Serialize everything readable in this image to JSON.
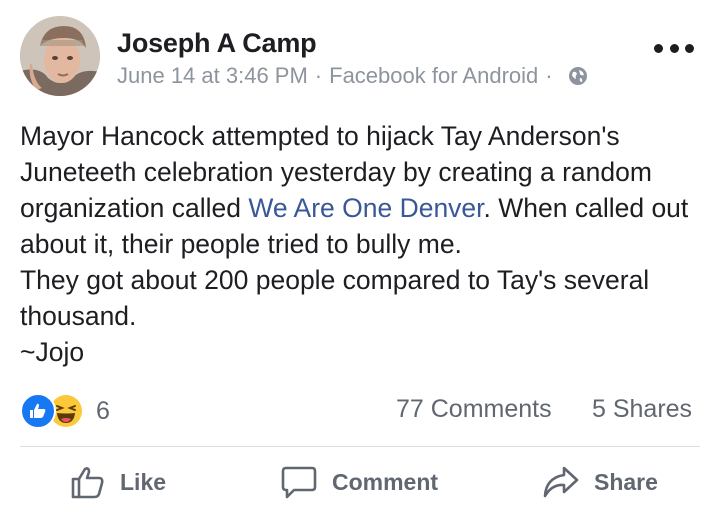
{
  "post": {
    "author": "Joseph A Camp",
    "timestamp": "June 14 at 3:46 PM",
    "separator": "·",
    "source": "Facebook for Android",
    "privacy_icon": "globe-icon",
    "menu_icon": "more-options-icon",
    "text": {
      "line1_a": "Mayor Hancock attempted to hijack Tay Anderson's Juneteeth celebration yesterday by creating a random organization called ",
      "link": "We Are One Denver",
      "line1_b": ". When called out about it, their people tried to bully me.",
      "line2": "They got about 200 people compared to Tay's several thousand.",
      "line3": "~Jojo"
    }
  },
  "stats": {
    "reaction_icons": [
      "like-reaction-icon",
      "haha-reaction-icon"
    ],
    "reaction_count": "6",
    "comments": "77 Comments",
    "shares": "5 Shares"
  },
  "actions": {
    "like": "Like",
    "comment": "Comment",
    "share": "Share"
  },
  "colors": {
    "text": "#1c1e21",
    "meta": "#8d949e",
    "link": "#385898",
    "like_blue": "#1877f2",
    "haha_yellow": "#fcc93a",
    "action_gray": "#606770"
  }
}
